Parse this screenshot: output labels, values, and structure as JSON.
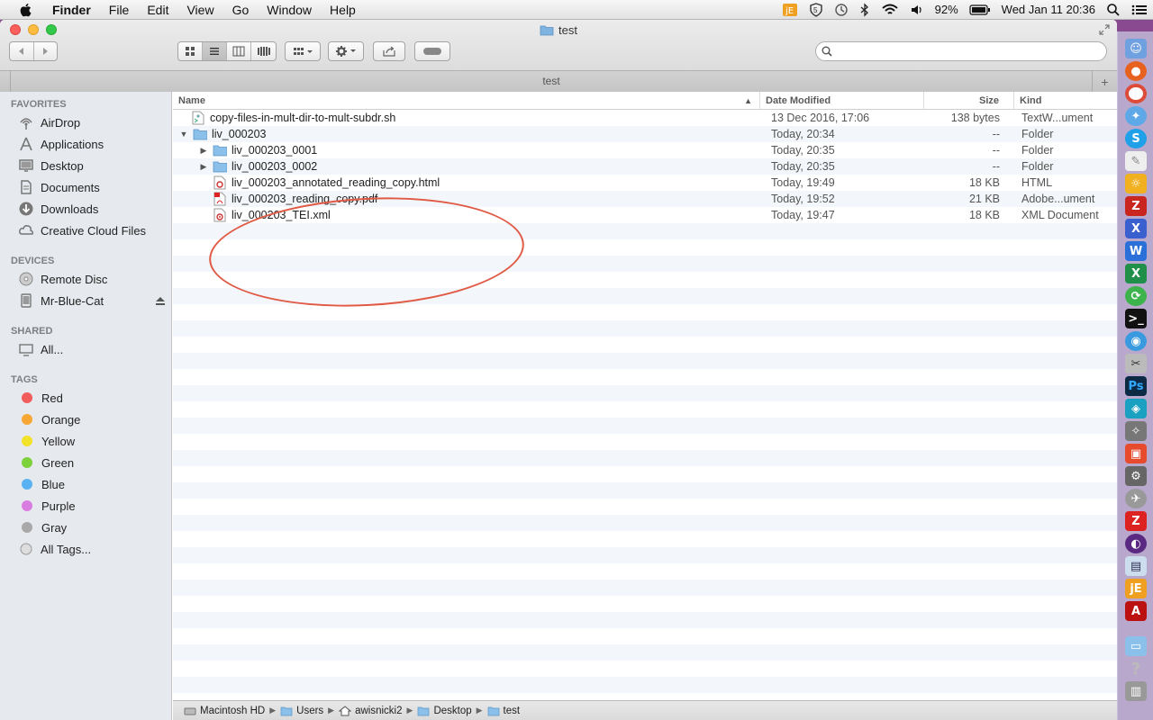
{
  "menubar": {
    "app_name": "Finder",
    "menus": [
      "File",
      "Edit",
      "View",
      "Go",
      "Window",
      "Help"
    ],
    "battery": "92%",
    "clock": "Wed Jan 11  20:36"
  },
  "window": {
    "title": "test",
    "tab_title": "test"
  },
  "sidebar": {
    "favorites_header": "FAVORITES",
    "favorites": [
      "AirDrop",
      "Applications",
      "Desktop",
      "Documents",
      "Downloads",
      "Creative Cloud Files"
    ],
    "devices_header": "DEVICES",
    "devices": [
      "Remote Disc",
      "Mr-Blue-Cat"
    ],
    "shared_header": "SHARED",
    "shared": [
      "All..."
    ],
    "tags_header": "TAGS",
    "tags": [
      {
        "label": "Red",
        "color": "#f25c5c"
      },
      {
        "label": "Orange",
        "color": "#f7a733"
      },
      {
        "label": "Yellow",
        "color": "#f2e22a"
      },
      {
        "label": "Green",
        "color": "#7dd13b"
      },
      {
        "label": "Blue",
        "color": "#5ab2f2"
      },
      {
        "label": "Purple",
        "color": "#d97de0"
      },
      {
        "label": "Gray",
        "color": "#a9a9a9"
      }
    ],
    "all_tags": "All Tags..."
  },
  "columns": {
    "name": "Name",
    "date": "Date Modified",
    "size": "Size",
    "kind": "Kind"
  },
  "files": [
    {
      "name": "copy-files-in-mult-dir-to-mult-subdr.sh",
      "date": "13 Dec 2016, 17:06",
      "size": "138 bytes",
      "kind": "TextW...ument"
    },
    {
      "name": "liv_000203",
      "date": "Today, 20:34",
      "size": "--",
      "kind": "Folder"
    },
    {
      "name": "liv_000203_0001",
      "date": "Today, 20:35",
      "size": "--",
      "kind": "Folder"
    },
    {
      "name": "liv_000203_0002",
      "date": "Today, 20:35",
      "size": "--",
      "kind": "Folder"
    },
    {
      "name": "liv_000203_annotated_reading_copy.html",
      "date": "Today, 19:49",
      "size": "18 KB",
      "kind": "HTML"
    },
    {
      "name": "liv_000203_reading_copy.pdf",
      "date": "Today, 19:52",
      "size": "21 KB",
      "kind": "Adobe...ument"
    },
    {
      "name": "liv_000203_TEI.xml",
      "date": "Today, 19:47",
      "size": "18 KB",
      "kind": "XML Document"
    }
  ],
  "pathbar": [
    "Macintosh HD",
    "Users",
    "awisnicki2",
    "Desktop",
    "test"
  ],
  "search": {
    "placeholder": ""
  },
  "colors": {
    "annotation": "#e05a45",
    "selection": "#3875d7"
  }
}
